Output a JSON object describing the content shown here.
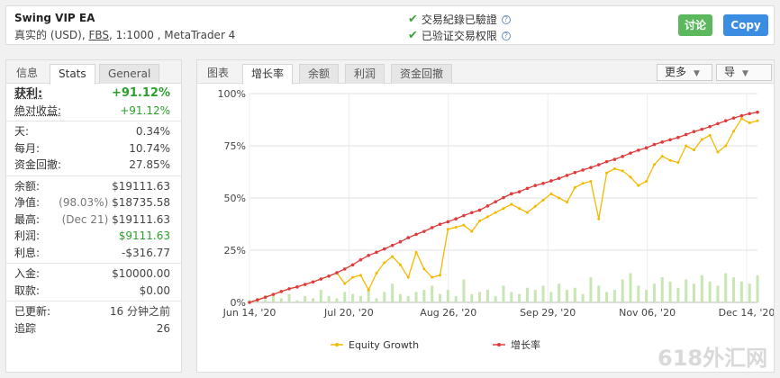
{
  "header": {
    "title": "Swing VIP EA",
    "sub_prefix": "真实的 (USD), ",
    "broker": "FBS",
    "sub_suffix": ", 1:1000 , MetaTrader 4",
    "verify_track": "交易紀錄已驗證",
    "verify_privilege": "已验证交易权限",
    "discuss_label": "讨论",
    "copy_label": "Copy",
    "discuss_color": "#5cb85c",
    "copy_color": "#3a8de0"
  },
  "left_tabs": [
    "信息",
    "Stats",
    "General"
  ],
  "stats": {
    "profit": {
      "label": "获利:",
      "value": "+91.12%"
    },
    "abs_gain": {
      "label": "绝对收益:",
      "value": "+91.12%"
    },
    "daily": {
      "label": "天:",
      "value": "0.34%"
    },
    "monthly": {
      "label": "每月:",
      "value": "10.74%"
    },
    "drawdown": {
      "label": "资金回撤:",
      "value": "27.85%"
    },
    "balance": {
      "label": "余额:",
      "value": "$19111.63"
    },
    "equity": {
      "label": "净值:",
      "note": "(98.03%)",
      "value": "$18735.58"
    },
    "highest": {
      "label": "最高:",
      "note": "(Dec 21)",
      "value": "$19111.63"
    },
    "profit_amt": {
      "label": "利润:",
      "value": "$9111.63"
    },
    "interest": {
      "label": "利息:",
      "value": "-$316.77"
    },
    "deposits": {
      "label": "入金:",
      "value": "$10000.00"
    },
    "withdrawals": {
      "label": "取款:",
      "value": "$0.00"
    },
    "updated": {
      "label": "已更新:",
      "value": "16 分钟之前"
    },
    "tracking": {
      "label": "追踪",
      "value": "26"
    }
  },
  "right_tabs": [
    "图表",
    "增长率",
    "余额",
    "利润",
    "资金回撤"
  ],
  "more_label": "更多",
  "export_label": "导",
  "watermark": "618外汇网",
  "chart_data": {
    "type": "line",
    "x_ticks": [
      "Jun 14, '20",
      "Jul 20, '20",
      "Aug 26, '20",
      "Sep 29, '20",
      "Nov 06, '20",
      "Dec 14, '20"
    ],
    "y_ticks": [
      "0%",
      "25%",
      "50%",
      "75%",
      "100%"
    ],
    "ylim": [
      0,
      100
    ],
    "grid": true,
    "legend": "bottom",
    "colors": {
      "growth": "#e03a3a",
      "equity": "#f5b800",
      "bars": "#c8e6b4"
    },
    "x": [
      0,
      3,
      6,
      9,
      12,
      15,
      18,
      21,
      24,
      27,
      30,
      33,
      36,
      39,
      42,
      45,
      48,
      51,
      54,
      57,
      60,
      63,
      66,
      69,
      72,
      75,
      78,
      81,
      84,
      87,
      90,
      93,
      96,
      99,
      102,
      105,
      108,
      111,
      114,
      117,
      120,
      123,
      126,
      129,
      132,
      135,
      138,
      141,
      144,
      147,
      150,
      153,
      156,
      159,
      162,
      165,
      168,
      171,
      174,
      177,
      180,
      183,
      186,
      189,
      192
    ],
    "series": [
      {
        "name": "增长率",
        "values": [
          0,
          1.2,
          2.5,
          3.8,
          5.2,
          6.5,
          7.4,
          8.6,
          9.8,
          11.2,
          12.6,
          14.2,
          16.0,
          18.0,
          20.4,
          22.5,
          24.0,
          25.6,
          27.3,
          29.0,
          31.0,
          32.6,
          34.0,
          35.8,
          37.4,
          38.6,
          40.0,
          41.6,
          43.0,
          44.2,
          46.2,
          48.2,
          50.2,
          52.0,
          53.0,
          54.6,
          56.0,
          57.0,
          58.2,
          59.4,
          60.8,
          62.2,
          63.4,
          64.6,
          65.9,
          67.4,
          68.5,
          69.9,
          71.5,
          72.9,
          74.0,
          75.6,
          76.8,
          77.9,
          79.0,
          80.4,
          81.8,
          82.9,
          84.2,
          85.6,
          87.0,
          88.3,
          89.4,
          90.4,
          91.1
        ]
      },
      {
        "name": "Equity Growth",
        "values": [
          0,
          1.2,
          2.5,
          3.8,
          5.2,
          6.5,
          7.4,
          8.6,
          9.8,
          11.2,
          12.6,
          14.2,
          9,
          12,
          13,
          6,
          14,
          19,
          22,
          18,
          12,
          24,
          16,
          12,
          13,
          35,
          36,
          37,
          34,
          39,
          41,
          43,
          45,
          47,
          45,
          43,
          46,
          49,
          52,
          50,
          48,
          55,
          57,
          58,
          40,
          62,
          64,
          63,
          60,
          56,
          58,
          66,
          70,
          68,
          67,
          75,
          73,
          78,
          80,
          72,
          75,
          82,
          88,
          86,
          87
        ]
      }
    ],
    "bar_values": [
      1,
      2,
      1.5,
      3,
      2,
      4,
      1,
      3,
      2,
      6,
      3,
      2,
      5,
      4,
      3,
      7,
      2,
      5,
      9,
      4,
      3,
      5,
      6,
      8,
      4,
      6,
      3,
      11,
      4,
      5,
      6,
      3,
      8,
      5,
      4,
      7,
      6,
      8,
      5,
      9,
      6,
      7,
      4,
      12,
      8,
      5,
      6,
      11,
      14,
      8,
      6,
      9,
      12,
      10,
      7,
      11,
      9,
      13,
      10,
      8,
      14,
      12,
      10,
      9,
      13
    ]
  }
}
